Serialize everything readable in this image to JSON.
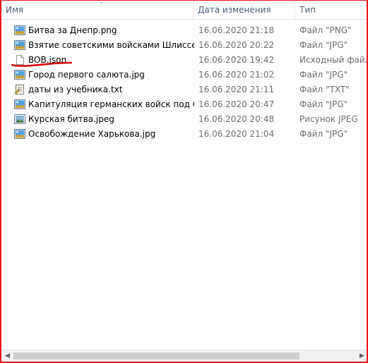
{
  "columns": {
    "name": "Имя",
    "date": "Дата изменения",
    "type": "Тип"
  },
  "files": [
    {
      "name": "Битва за Днепр.png",
      "date": "16.06.2020 21:18",
      "type": "Файл \"PNG\"",
      "icon": "image-icon"
    },
    {
      "name": "Взятие советскими войсками Шлиссел...",
      "date": "16.06.2020 20:22",
      "type": "Файл \"JPG\"",
      "icon": "image-icon"
    },
    {
      "name": "BOB.json",
      "date": "16.06.2020 19:42",
      "type": "Исходный файл J",
      "icon": "json-file-icon"
    },
    {
      "name": "Город первого салюта.jpg",
      "date": "16.06.2020 21:02",
      "type": "Файл \"JPG\"",
      "icon": "image-icon"
    },
    {
      "name": "даты из учебника.txt",
      "date": "16.06.2020 21:11",
      "type": "Файл \"TXT\"",
      "icon": "text-file-icon"
    },
    {
      "name": "Капитуляция германских войск под Ст...",
      "date": "16.06.2020 20:47",
      "type": "Файл \"JPG\"",
      "icon": "image-icon"
    },
    {
      "name": "Курская битва.jpeg",
      "date": "16.06.2020 20:48",
      "type": "Рисунок JPEG",
      "icon": "jpeg-icon"
    },
    {
      "name": "Освобождение Харькова.jpg",
      "date": "16.06.2020 21:04",
      "type": "Файл \"JPG\"",
      "icon": "image-icon"
    }
  ],
  "annotation_color": "#d40000",
  "frame_color": "#e81123"
}
